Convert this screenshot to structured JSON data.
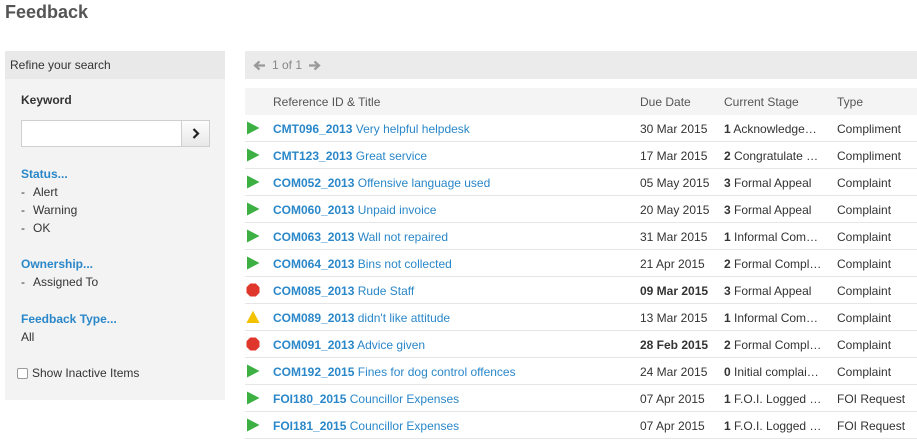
{
  "page": {
    "title": "Feedback"
  },
  "sidebar": {
    "header": "Refine your search",
    "keyword_label": "Keyword",
    "keyword_value": "",
    "status_title": "Status...",
    "status_items": [
      "Alert",
      "Warning",
      "OK"
    ],
    "ownership_title": "Ownership...",
    "ownership_items": [
      "Assigned To"
    ],
    "feedback_type_title": "Feedback Type...",
    "feedback_type_value": "All",
    "show_inactive_label": "Show Inactive Items"
  },
  "pager": {
    "text": "1 of 1"
  },
  "table": {
    "headers": {
      "ref": "Reference ID & Title",
      "due": "Due Date",
      "stage": "Current Stage",
      "type": "Type"
    },
    "rows": [
      {
        "status": "ok",
        "id": "CMT096_2013",
        "title": "Very helpful helpdesk",
        "due": "30 Mar 2015",
        "overdue": false,
        "stage_num": "1",
        "stage": "Acknowledge…",
        "type": "Compliment"
      },
      {
        "status": "ok",
        "id": "CMT123_2013",
        "title": "Great service",
        "due": "17 Mar 2015",
        "overdue": false,
        "stage_num": "2",
        "stage": "Congratulate …",
        "type": "Compliment"
      },
      {
        "status": "ok",
        "id": "COM052_2013",
        "title": "Offensive language used",
        "due": "05 May 2015",
        "overdue": false,
        "stage_num": "3",
        "stage": "Formal Appeal",
        "type": "Complaint"
      },
      {
        "status": "ok",
        "id": "COM060_2013",
        "title": "Unpaid invoice",
        "due": "20 May 2015",
        "overdue": false,
        "stage_num": "3",
        "stage": "Formal Appeal",
        "type": "Complaint"
      },
      {
        "status": "ok",
        "id": "COM063_2013",
        "title": "Wall not repaired",
        "due": "31 Mar 2015",
        "overdue": false,
        "stage_num": "1",
        "stage": "Informal Com…",
        "type": "Complaint"
      },
      {
        "status": "ok",
        "id": "COM064_2013",
        "title": "Bins not collected",
        "due": "21 Apr 2015",
        "overdue": false,
        "stage_num": "2",
        "stage": "Formal Compl…",
        "type": "Complaint"
      },
      {
        "status": "alert",
        "id": "COM085_2013",
        "title": "Rude Staff",
        "due": "09 Mar 2015",
        "overdue": true,
        "stage_num": "3",
        "stage": "Formal Appeal",
        "type": "Complaint"
      },
      {
        "status": "warning",
        "id": "COM089_2013",
        "title": "didn't like attitude",
        "due": "13 Mar 2015",
        "overdue": false,
        "stage_num": "1",
        "stage": "Informal Com…",
        "type": "Complaint"
      },
      {
        "status": "alert",
        "id": "COM091_2013",
        "title": "Advice given",
        "due": "28 Feb 2015",
        "overdue": true,
        "stage_num": "2",
        "stage": "Formal Compl…",
        "type": "Complaint"
      },
      {
        "status": "ok",
        "id": "COM192_2015",
        "title": "Fines for dog control offences",
        "due": "24 Mar 2015",
        "overdue": false,
        "stage_num": "0",
        "stage": "Initial complai…",
        "type": "Complaint"
      },
      {
        "status": "ok",
        "id": "FOI180_2015",
        "title": "Councillor Expenses",
        "due": "07 Apr 2015",
        "overdue": false,
        "stage_num": "1",
        "stage": "F.O.I. Logged …",
        "type": "FOI Request"
      },
      {
        "status": "ok",
        "id": "FOI181_2015",
        "title": "Councillor Expenses",
        "due": "07 Apr 2015",
        "overdue": false,
        "stage_num": "1",
        "stage": "F.O.I. Logged …",
        "type": "FOI Request"
      }
    ]
  },
  "icons": {
    "ok": "play-triangle-icon",
    "alert": "stop-octagon-icon",
    "warning": "warning-triangle-icon"
  },
  "colors": {
    "link": "#2a87c9",
    "ok": "#3cb043",
    "alert": "#e0372c",
    "warning": "#f2c200"
  }
}
